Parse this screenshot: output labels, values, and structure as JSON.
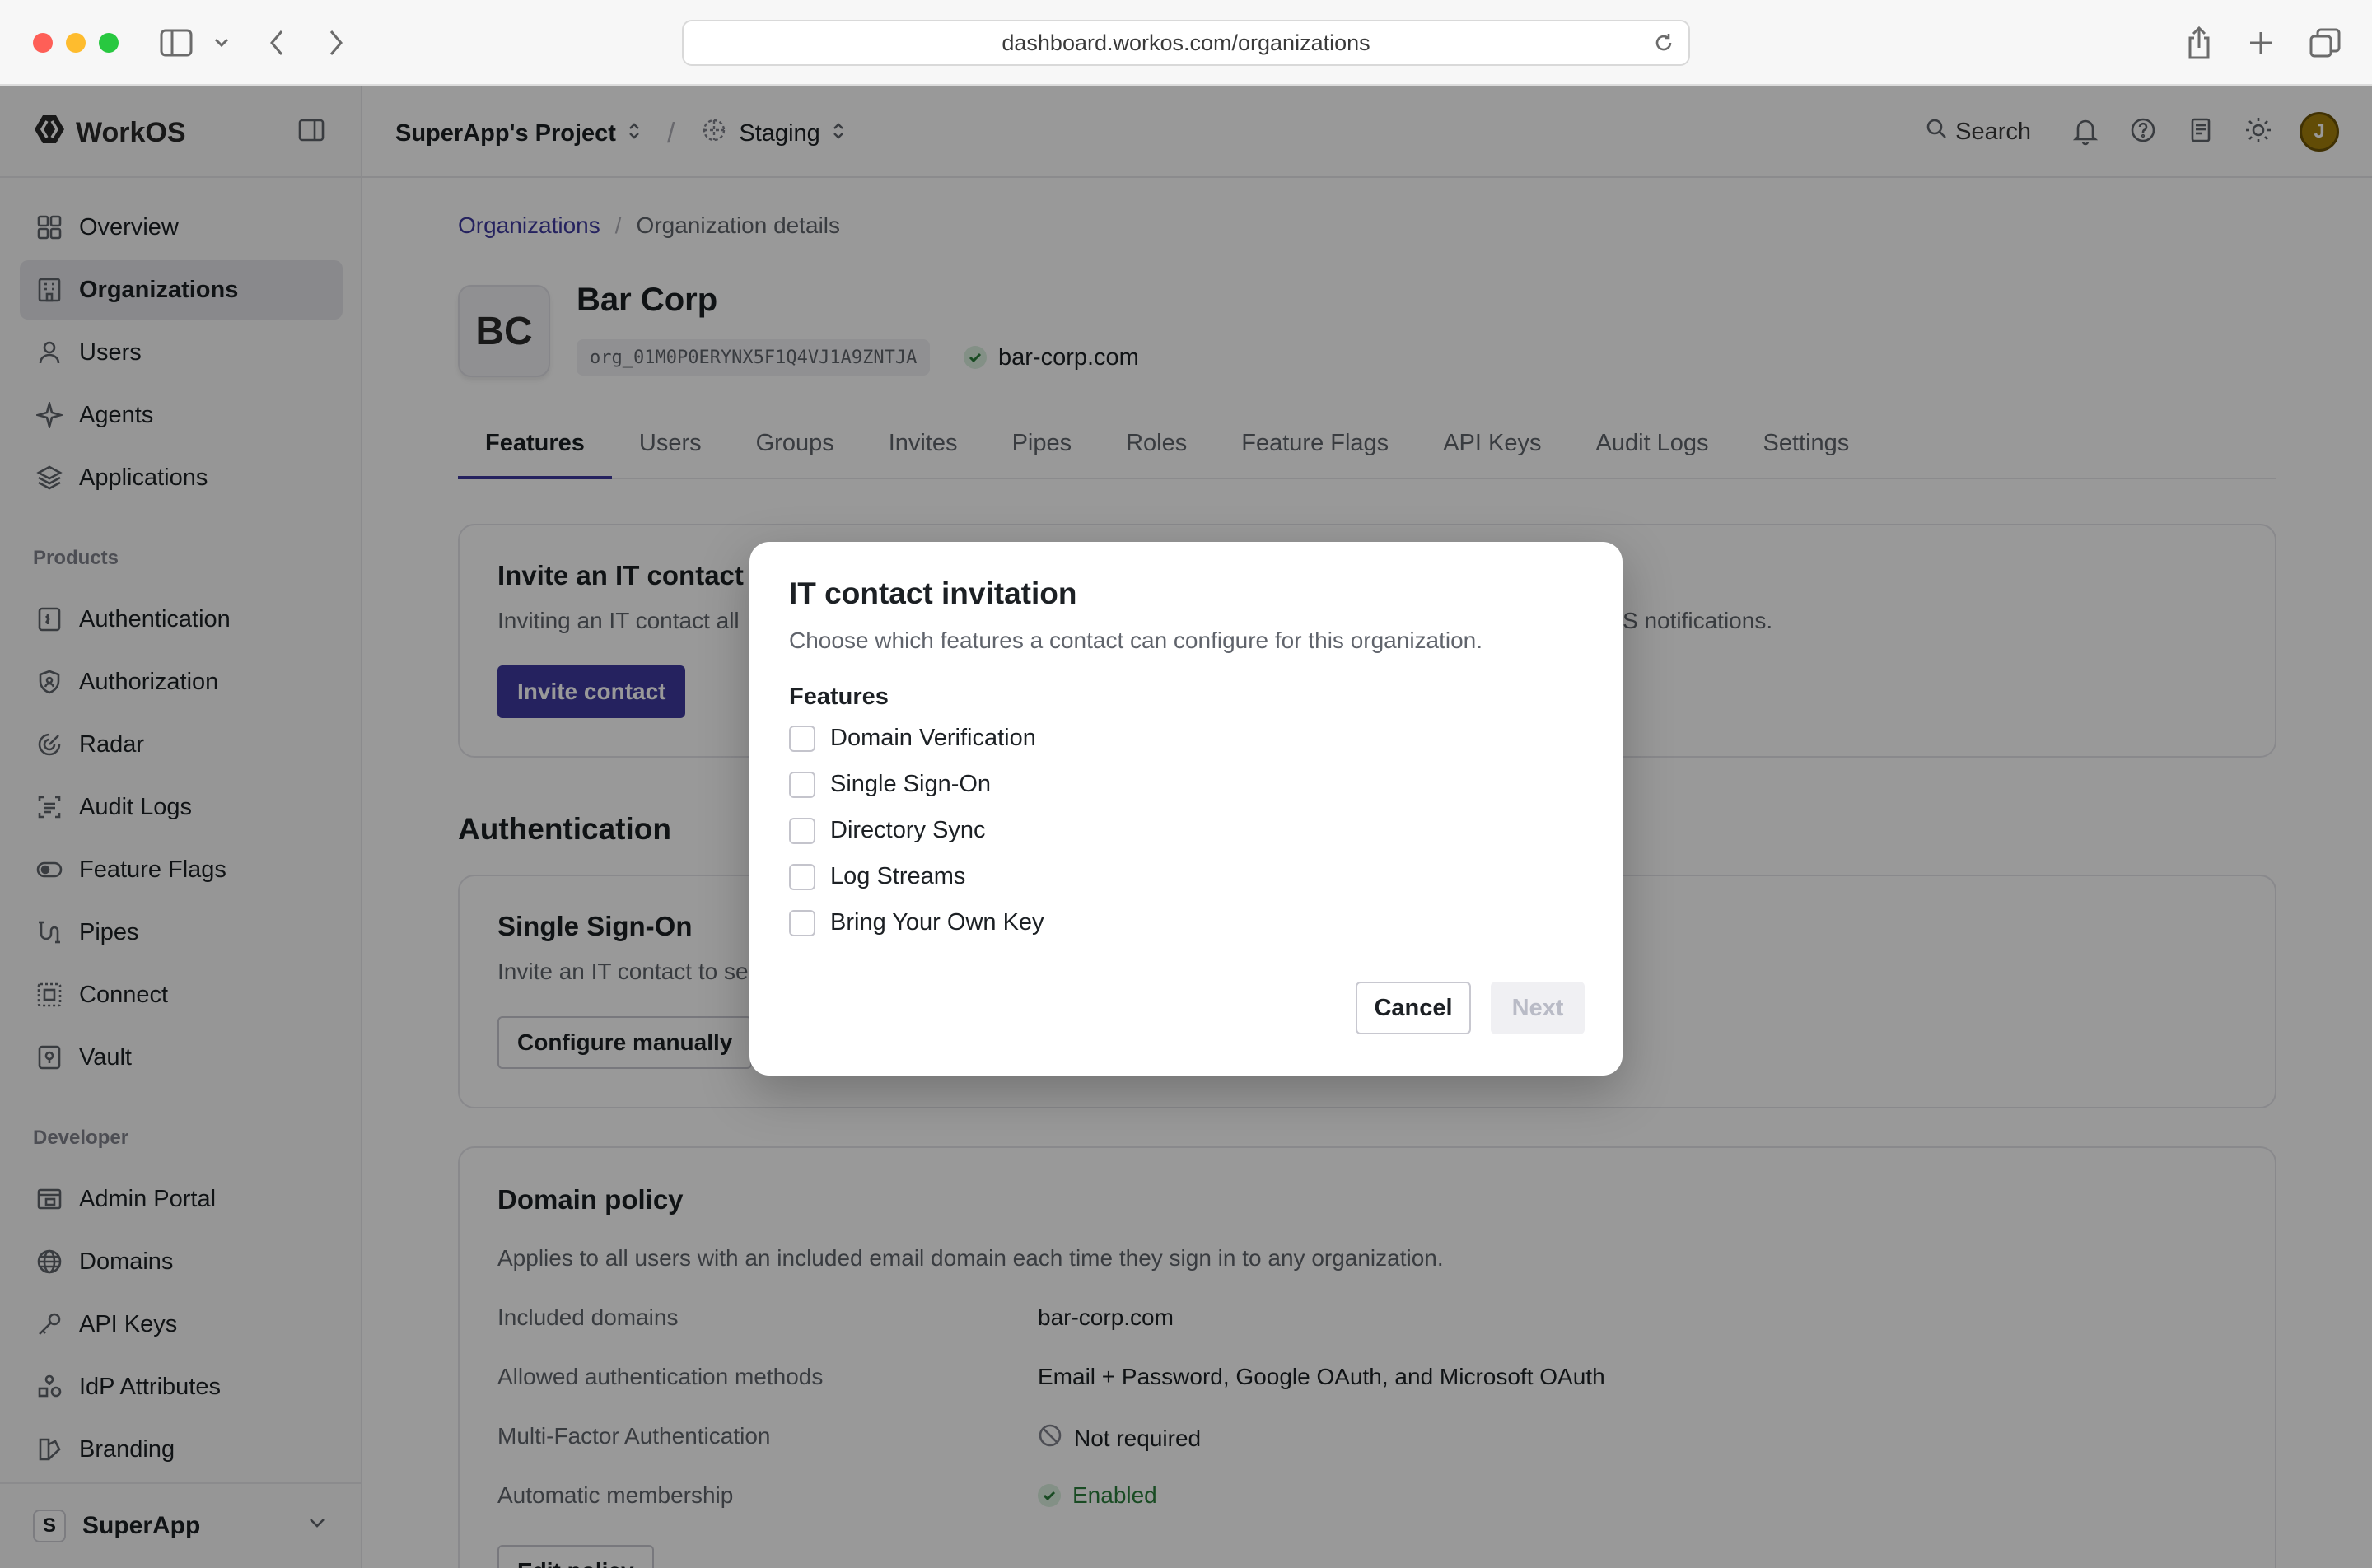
{
  "browser": {
    "url": "dashboard.workos.com/organizations"
  },
  "sidebar": {
    "brand": "WorkOS",
    "main_items": [
      {
        "label": "Overview",
        "icon": "grid-icon"
      },
      {
        "label": "Organizations",
        "icon": "building-icon",
        "active": true
      },
      {
        "label": "Users",
        "icon": "user-icon"
      },
      {
        "label": "Agents",
        "icon": "sparkle-icon"
      },
      {
        "label": "Applications",
        "icon": "layers-icon"
      }
    ],
    "products_label": "Products",
    "product_items": [
      {
        "label": "Authentication",
        "icon": "login-icon"
      },
      {
        "label": "Authorization",
        "icon": "shield-icon"
      },
      {
        "label": "Radar",
        "icon": "radar-icon"
      },
      {
        "label": "Audit Logs",
        "icon": "audit-icon"
      },
      {
        "label": "Feature Flags",
        "icon": "toggle-icon"
      },
      {
        "label": "Pipes",
        "icon": "pipes-icon"
      },
      {
        "label": "Connect",
        "icon": "connect-icon"
      },
      {
        "label": "Vault",
        "icon": "vault-icon"
      }
    ],
    "developer_label": "Developer",
    "developer_items": [
      {
        "label": "Admin Portal",
        "icon": "portal-icon"
      },
      {
        "label": "Domains",
        "icon": "globe-icon"
      },
      {
        "label": "API Keys",
        "icon": "key-icon"
      },
      {
        "label": "IdP Attributes",
        "icon": "attributes-icon"
      },
      {
        "label": "Branding",
        "icon": "branding-icon"
      }
    ],
    "workspace": {
      "badge": "S",
      "name": "SuperApp"
    }
  },
  "topbar": {
    "project": "SuperApp's Project",
    "separator": "/",
    "environment": "Staging",
    "search_label": "Search",
    "avatar_initial": "J"
  },
  "breadcrumb": {
    "parent": "Organizations",
    "separator": "/",
    "current": "Organization details"
  },
  "organization": {
    "initials": "BC",
    "name": "Bar Corp",
    "id": "org_01M0P0ERYNX5F1Q4VJ1A9ZNTJA",
    "domain": "bar-corp.com"
  },
  "tabs": [
    "Features",
    "Users",
    "Groups",
    "Invites",
    "Pipes",
    "Roles",
    "Feature Flags",
    "API Keys",
    "Audit Logs",
    "Settings"
  ],
  "invite_card": {
    "title": "Invite an IT contact t",
    "desc_left": "Inviting an IT contact all",
    "desc_right": "S notifications.",
    "button": "Invite contact"
  },
  "authentication_section": {
    "title": "Authentication",
    "sso_title": "Single Sign-On",
    "sso_desc": "Invite an IT contact to se",
    "sso_button": "Configure manually"
  },
  "domain_policy": {
    "title": "Domain policy",
    "description": "Applies to all users with an included email domain each time they sign in to any organization.",
    "rows": [
      {
        "label": "Included domains",
        "value": "bar-corp.com"
      },
      {
        "label": "Allowed authentication methods",
        "value": "Email + Password, Google OAuth, and Microsoft OAuth"
      },
      {
        "label": "Multi-Factor Authentication",
        "value": "Not required"
      },
      {
        "label": "Automatic membership",
        "value": "Enabled"
      }
    ],
    "edit_button": "Edit policy"
  },
  "modal": {
    "title": "IT contact invitation",
    "description": "Choose which features a contact can configure for this organization.",
    "features_label": "Features",
    "options": [
      "Domain Verification",
      "Single Sign-On",
      "Directory Sync",
      "Log Streams",
      "Bring Your Own Key"
    ],
    "cancel_label": "Cancel",
    "next_label": "Next"
  },
  "colors": {
    "accent": "#3e3a9e",
    "success": "#2a7e3b",
    "muted_text": "#60646c"
  }
}
